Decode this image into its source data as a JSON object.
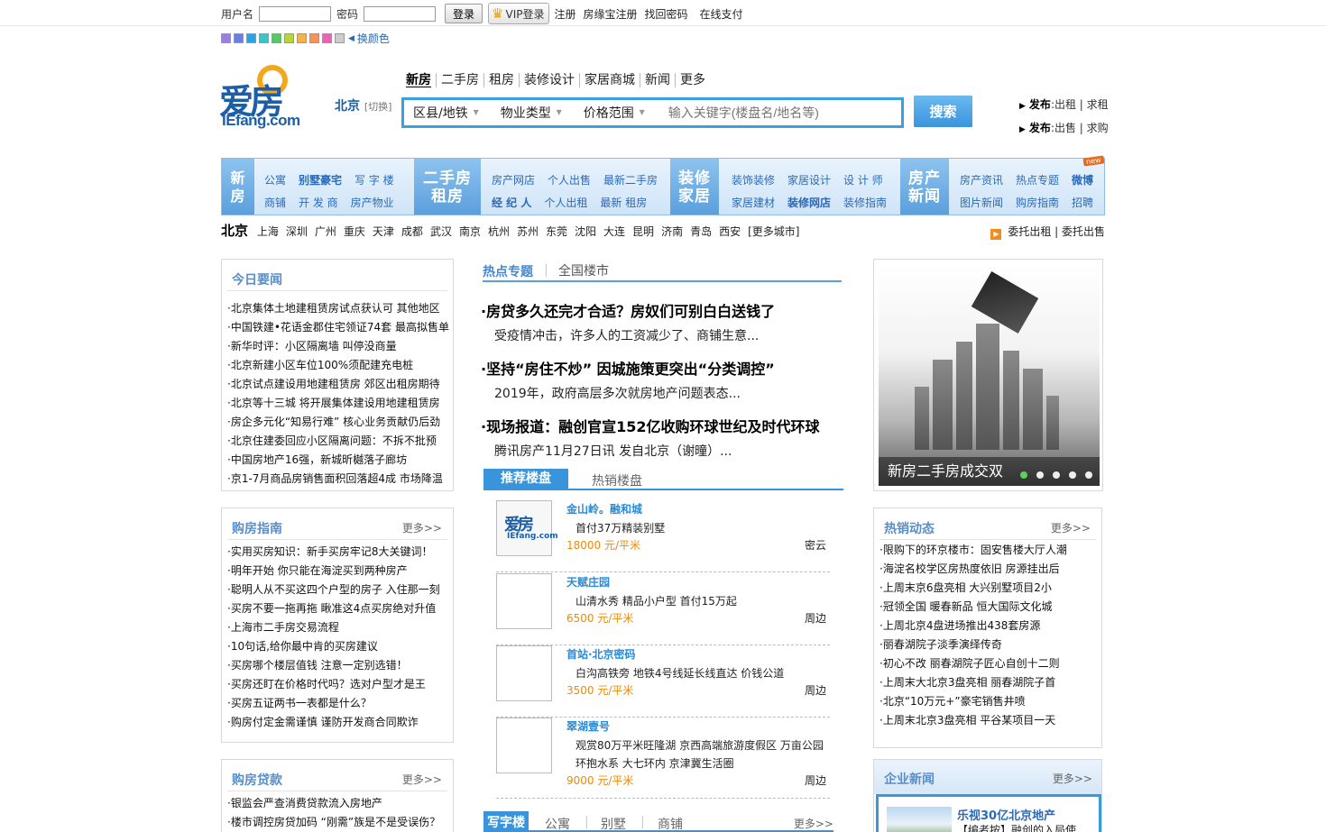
{
  "topbar": {
    "username_label": "用户名",
    "password_label": "密码",
    "login_button": "登录",
    "vip_login": "VIP登录",
    "links": [
      "注册",
      "房缘宝注册",
      "找回密码",
      "在线支付"
    ]
  },
  "skin": {
    "swatch_colors": [
      "#9b7fe0",
      "#6a7fe0",
      "#2fa0e0",
      "#3cc3c8",
      "#55c867",
      "#b5d63a",
      "#f5b24a",
      "#f5935c",
      "#e865b4",
      "#cccccc"
    ],
    "change_label": "换颜色"
  },
  "logo": {
    "zh": "爱房",
    "en": "IEfang.com"
  },
  "city": {
    "name": "北京",
    "switch": "[切换]"
  },
  "nav": [
    "新房",
    "二手房",
    "租房",
    "装修设计",
    "家居商城",
    "新闻",
    "更多"
  ],
  "search": {
    "dropdowns": [
      "区县/地铁",
      "物业类型",
      "价格范围"
    ],
    "placeholder": "输入关键字(楼盘名/地名等)",
    "button": "搜索"
  },
  "publish": [
    {
      "label": "发布",
      "items": "出租 | 求租"
    },
    {
      "label": "发布",
      "items": "出售 | 求购"
    }
  ],
  "channels": [
    {
      "title": "新房",
      "row1": [
        "公寓",
        "别墅豪宅",
        "写 字 楼"
      ],
      "row2": [
        "商铺",
        "开 发 商",
        "房产物业"
      ]
    },
    {
      "title": "二手房租房",
      "row1": [
        "房产网店",
        "个人出售",
        "最新二手房"
      ],
      "row2": [
        "经 纪 人",
        "个人出租",
        "最新 租房"
      ]
    },
    {
      "title": "装修家居",
      "row1": [
        "装饰装修",
        "家居设计",
        "设 计 师"
      ],
      "row2": [
        "家居建材",
        "装修网店",
        "装修指南"
      ]
    },
    {
      "title": "房产新闻",
      "row1": [
        "房产资讯",
        "热点专题",
        "微博"
      ],
      "row2": [
        "图片新闻",
        "购房指南",
        "招聘"
      ]
    }
  ],
  "new_tag": "new",
  "cityrow": {
    "current": "北京",
    "cities": [
      "上海",
      "深圳",
      "广州",
      "重庆",
      "天津",
      "成都",
      "武汉",
      "南京",
      "杭州",
      "苏州",
      "东莞",
      "沈阳",
      "大连",
      "昆明",
      "济南",
      "青岛",
      "西安",
      "[更多城市]"
    ],
    "right": "委托出租 | 委托出售"
  },
  "today": {
    "title": "今日要闻",
    "items": [
      "·北京集体土地建租赁房试点获认可 其他地区",
      "·中国铁建•花语金郡住宅领证74套 最高拟售单",
      "·新华时评：小区隔离墙 叫停没商量",
      "·北京新建小区车位100%须配建充电桩",
      "·北京试点建设用地建租赁房 郊区出租房期待",
      "·北京等十三城 将开展集体建设用地建租赁房",
      "·房企多元化“知易行难” 核心业务贡献仍后劲",
      "·北京住建委回应小区隔离问题：不拆不批预",
      "·中国房地产16强，新城昕樾落子廊坊",
      "·京1-7月商品房销售面积回落超4成 市场降温"
    ]
  },
  "guide": {
    "title": "购房指南",
    "more": "更多>>",
    "items": [
      "·实用买房知识：新手买房牢记8大关键词！",
      "·明年开始 你只能在海淀买到两种房产",
      "·聪明人从不买这四个户型的房子 入住那一刻",
      "·买房不要一拖再拖 瞅准这4点买房绝对升值",
      "·上海市二手房交易流程",
      "·10句话,给你最中肯的买房建议",
      "·买房哪个楼层值钱 注意一定别选错！",
      "·买房还盯在价格时代吗？选对户型才是王",
      "·买房五证两书一表都是什么？",
      "·购房付定金需谨慎 谨防开发商合同欺诈"
    ]
  },
  "loan": {
    "title": "购房贷款",
    "more": "更多>>",
    "items": [
      "·银监会严查消费贷款流入房地产",
      "·楼市调控房贷加码 “刚需”族是不是受误伤？"
    ]
  },
  "hot": {
    "tabs": [
      "热点专题",
      "全国楼市"
    ],
    "news": [
      {
        "title": "·房贷多久还完才合适？房奴们可别白白送钱了",
        "desc": "受疫情冲击，许多人的工资减少了、商铺生意..."
      },
      {
        "title": "·坚持“房住不炒” 因城施策更突出“分类调控”",
        "desc": "2019年，政府高层多次就房地产问题表态..."
      },
      {
        "title": "·现场报道：融创官宣152亿收购环球世纪及时代环球",
        "desc": "腾讯房产11月27日讯 发自北京（谢曈）..."
      }
    ]
  },
  "slider": {
    "caption": "新房二手房成交双",
    "dots": 5,
    "active": 0
  },
  "recommend": {
    "tabs": [
      "推荐楼盘",
      "热销楼盘"
    ],
    "thumb_logo_zh": "爱房",
    "thumb_logo_en": "IEfang.com",
    "items": [
      {
        "name": "金山岭。融和城",
        "desc": [
          "首付37万精装别墅"
        ],
        "price": "18000 元/平米",
        "area": "密云",
        "logo": true
      },
      {
        "name": "天赋庄园",
        "desc": [
          "山清水秀 精品小户型 首付15万起"
        ],
        "price": "6500 元/平米",
        "area": "周边",
        "logo": false
      },
      {
        "name": "首站·北京密码",
        "desc": [
          "白沟高铁旁 地铁4号线延长线直达 价钱公道"
        ],
        "price": "3500 元/平米",
        "area": "周边",
        "logo": false
      },
      {
        "name": "翠湖壹号",
        "desc": [
          "观赏80万平米旺隆湖 京西高端旅游度假区 万亩公园",
          "环抱水系 大七环内 京津冀生活圈"
        ],
        "price": "9000 元/平米",
        "area": "周边",
        "logo": false
      }
    ]
  },
  "bottom_tabs": {
    "active": "写字楼",
    "others": [
      "公寓",
      "别墅",
      "商铺"
    ],
    "more": "更多>>"
  },
  "hotsale": {
    "title": "热销动态",
    "more": "更多>>",
    "items": [
      "·限购下的环京楼市：固安售楼大厅人潮",
      "·海淀名校学区房热度依旧 房源挂出后",
      "·上周末京6盘亮相 大兴别墅项目2小",
      "·冠领全国 暖春新品 恒大国际文化城",
      "·上周北京4盘进场推出438套房源",
      "·丽春湖院子淡季演绎传奇",
      "·初心不改 丽春湖院子匠心自创十二则",
      "·上周末大北京3盘亮相 丽春湖院子首",
      "·北京“10万元+”豪宅销售井喷",
      "·上周末北京3盘亮相 平谷某项目一天"
    ]
  },
  "enterprise": {
    "title": "企业新闻",
    "more": "更多>>",
    "headline": "乐视30亿北京地产",
    "sub": "【编者按】融创的入局使"
  }
}
